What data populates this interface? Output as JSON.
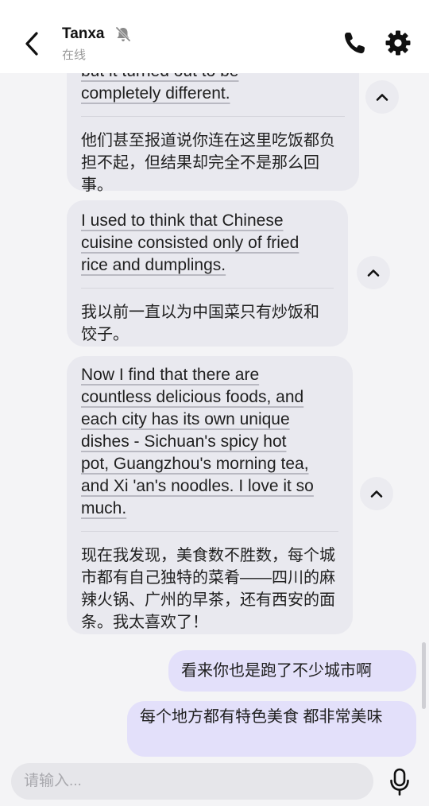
{
  "header": {
    "contact_name": "Tanxa",
    "status": "在线"
  },
  "icons": {
    "back": "back-chevron-icon",
    "mute": "bell-muted-icon",
    "phone": "phone-icon",
    "settings": "gear-icon",
    "collapse": "chevron-up-icon",
    "mic": "microphone-icon"
  },
  "messages": [
    {
      "en": [
        "but it turned out to be",
        "completely different."
      ],
      "zh": "他们甚至报道说你连在这里吃饭都负担不起，但结果却完全不是那么回事。"
    },
    {
      "en": [
        "I used to think that Chinese",
        "cuisine consisted only of fried",
        "rice and dumplings."
      ],
      "zh": "我以前一直以为中国菜只有炒饭和饺子。"
    },
    {
      "en": [
        "Now I find that there are",
        "countless delicious foods, and",
        "each city has its own unique",
        "dishes - Sichuan's spicy hot",
        "pot, Guangzhou's morning tea,",
        "and Xi 'an's noodles. I love it so",
        "much."
      ],
      "zh": "现在我发现，美食数不胜数，每个城市都有自己独特的菜肴——四川的麻辣火锅、广州的早茶，还有西安的面条。我太喜欢了！"
    }
  ],
  "sent_messages": [
    "看来你也是跑了不少城市啊",
    "每个地方都有特色美食 都非常美味"
  ],
  "input": {
    "placeholder": "请输入..."
  },
  "colors": {
    "received_bubble": "#e9e9ef",
    "sent_bubble": "#e3e0fa",
    "background": "#f4f4f6"
  }
}
